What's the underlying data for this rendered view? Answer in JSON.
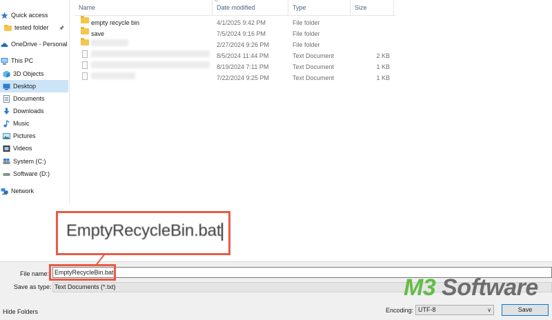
{
  "sidebar": {
    "quick_access": "Quick access",
    "items": [
      {
        "label": "tested folder",
        "icon": "folder-icon",
        "pinned": true
      },
      {
        "label": "OneDrive - Personal",
        "icon": "onedrive-cloud-icon"
      },
      {
        "label": "This PC",
        "icon": "this-pc-icon"
      },
      {
        "label": "3D Objects",
        "icon": "3d-objects-icon"
      },
      {
        "label": "Desktop",
        "icon": "desktop-icon",
        "selected": true
      },
      {
        "label": "Documents",
        "icon": "documents-icon"
      },
      {
        "label": "Downloads",
        "icon": "downloads-icon"
      },
      {
        "label": "Music",
        "icon": "music-icon"
      },
      {
        "label": "Pictures",
        "icon": "pictures-icon"
      },
      {
        "label": "Videos",
        "icon": "videos-icon"
      },
      {
        "label": "System (C:)",
        "icon": "drive-icon"
      },
      {
        "label": "Software (D:)",
        "icon": "drive-icon"
      },
      {
        "label": "Network",
        "icon": "network-icon"
      }
    ]
  },
  "columns": {
    "name": "Name",
    "date": "Date modified",
    "type": "Type",
    "size": "Size"
  },
  "files": [
    {
      "name": "empty recycle bin",
      "date": "4/1/2025 9:42 PM",
      "type": "File folder",
      "size": ""
    },
    {
      "name": "save",
      "date": "7/5/2024 9:16 PM",
      "type": "File folder",
      "size": ""
    },
    {
      "name": "",
      "date": "2/27/2024 9:26 PM",
      "type": "File folder",
      "size": ""
    },
    {
      "name": "",
      "date": "8/5/2024 11:44 PM",
      "type": "Text Document",
      "size": "2 KB"
    },
    {
      "name": "",
      "date": "8/19/2024 7:11 PM",
      "type": "Text Document",
      "size": "1 KB"
    },
    {
      "name": "",
      "date": "7/22/2024 9:25 PM",
      "type": "Text Document",
      "size": "1 KB"
    }
  ],
  "zoom_callout": {
    "text": "EmptyRecycleBin.bat"
  },
  "form": {
    "file_name_label": "File name:",
    "file_name_value": "EmptyRecycleBin.bat",
    "save_type_label": "Save as type:",
    "save_type_value": "Text Documents (*.txt)",
    "hide_folders": "Hide Folders",
    "encoding_label": "Encoding:",
    "encoding_value": "UTF-8",
    "save_button": "Save"
  },
  "watermark": {
    "part1": "M3",
    "part2": " Software"
  },
  "colors": {
    "accent_red": "#e85a45",
    "selected_bg": "#cce4f7",
    "brand_green": "#63bd45"
  }
}
